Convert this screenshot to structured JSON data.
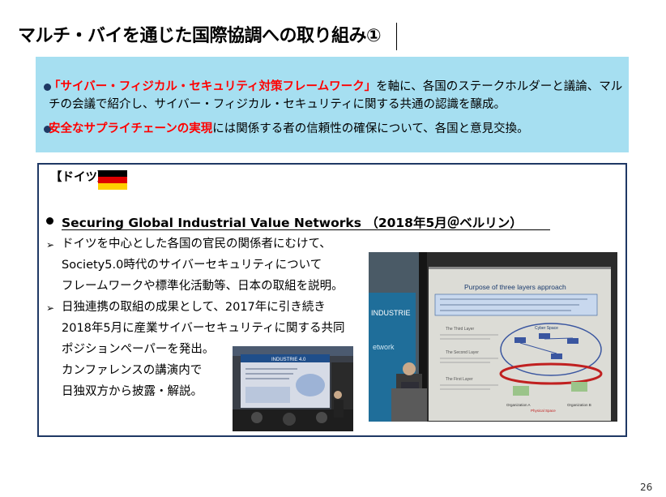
{
  "page": {
    "title": "マルチ・バイを通じた国際協調への取り組み①",
    "page_number": "26"
  },
  "summary": {
    "bullet1_red": "「サイバー・フィジカル・セキュリティ対策フレームワーク」",
    "bullet1_rest": "を軸に、各国のステークホルダーと議論、マル",
    "bullet1_line2": "チの会議で紹介し、サイバー・フィジカル・セキュリティに関する共通の認識を醸成。",
    "bullet2_red": "安全なサプライチェーンの実現",
    "bullet2_rest": "には関係する者の信頼性の確保について、各国と意見交換。"
  },
  "germany": {
    "country_label": "【ドイツ】",
    "heading": "Securing Global Industrial Value Networks （2018年5月＠ベルリン）",
    "items": [
      {
        "lines": [
          "ドイツを中心とした各国の官民の関係者にむけて、",
          "Society5.0時代のサイバーセキュリティについて",
          "フレームワークや標準化活動等、日本の取組を説明。"
        ]
      },
      {
        "lines": [
          "日独連携の取組の成果として、2017年に引き続き",
          "2018年5月に産業サイバーセキュリティに関する共同",
          "ポジションペーパーを発出。",
          "カンファレンスの講演内で",
          "日独双方から披露・解説。"
        ]
      }
    ],
    "slide_large": {
      "title": "Purpose of three layers approach",
      "layer1": "The First Layer",
      "layer2": "The Second Layer",
      "layer3": "The Third Layer",
      "node_cyber": "Cyber Space",
      "node_org_a": "Organization A",
      "node_org_b": "Organization B",
      "node_physical": "Physical Space"
    },
    "slide_small": {
      "banner": "INDUSTRIE 4.0"
    },
    "flag_colors": [
      "#000000",
      "#dd0000",
      "#ffce00"
    ]
  }
}
